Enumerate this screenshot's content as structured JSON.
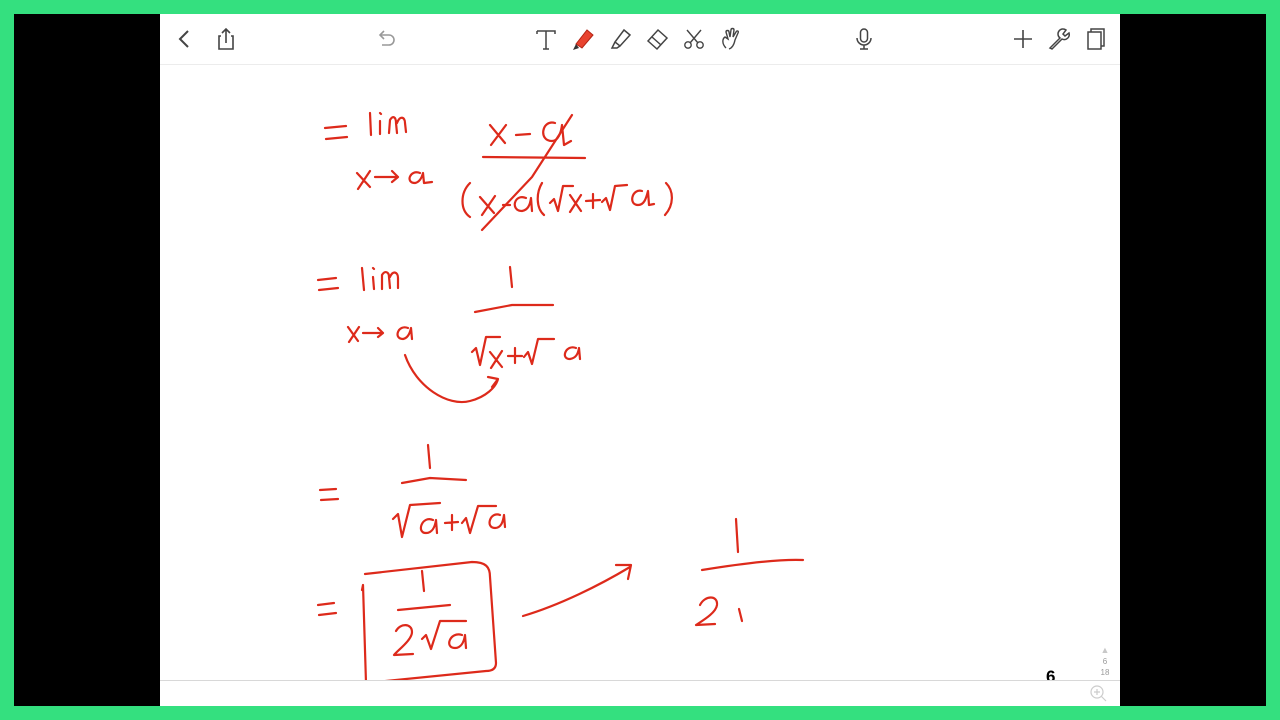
{
  "toolbar": {
    "left": [
      "back-icon",
      "share-icon"
    ],
    "center_left": [
      "undo-icon"
    ],
    "tools": [
      "text-tool-icon",
      "pen-tool-icon",
      "highlighter-tool-icon",
      "eraser-tool-icon",
      "lasso-scissors-icon",
      "shapes-hand-icon"
    ],
    "center_right": [
      "microphone-icon"
    ],
    "right": [
      "add-icon",
      "wrench-icon",
      "page-view-icon"
    ],
    "accent_color": "#e8432f"
  },
  "page": {
    "number": "6",
    "current": "6",
    "total": "18"
  },
  "ink_color": "#dd2a1b"
}
